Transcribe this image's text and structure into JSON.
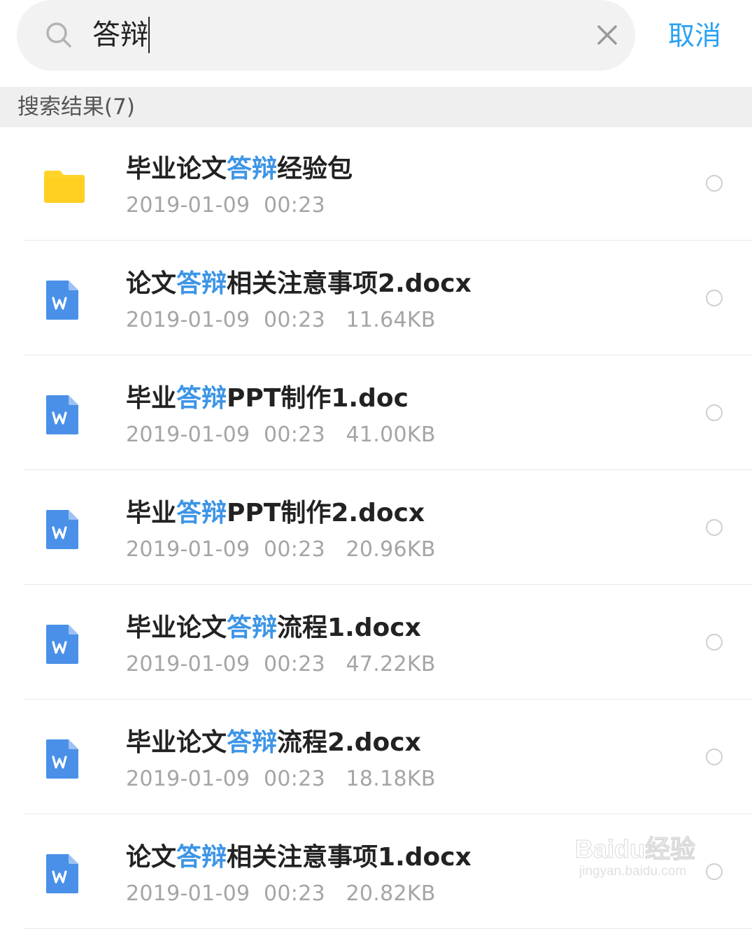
{
  "search": {
    "query": "答辩",
    "cancel_label": "取消"
  },
  "results_header": "搜索结果(7)",
  "highlight_color": "#3d95e6",
  "items": [
    {
      "type": "folder",
      "icon": "folder-icon",
      "title_before": "毕业论文",
      "title_match": "答辩",
      "title_after": "经验包",
      "meta": "2019-01-09  00:23"
    },
    {
      "type": "word",
      "icon": "word-doc-icon",
      "title_before": "论文",
      "title_match": "答辩",
      "title_after": "相关注意事项2.docx",
      "meta": "2019-01-09  00:23   11.64KB"
    },
    {
      "type": "word",
      "icon": "word-doc-icon",
      "title_before": "毕业",
      "title_match": "答辩",
      "title_after": "PPT制作1.doc",
      "meta": "2019-01-09  00:23   41.00KB"
    },
    {
      "type": "word",
      "icon": "word-doc-icon",
      "title_before": "毕业",
      "title_match": "答辩",
      "title_after": "PPT制作2.docx",
      "meta": "2019-01-09  00:23   20.96KB"
    },
    {
      "type": "word",
      "icon": "word-doc-icon",
      "title_before": "毕业论文",
      "title_match": "答辩",
      "title_after": "流程1.docx",
      "meta": "2019-01-09  00:23   47.22KB"
    },
    {
      "type": "word",
      "icon": "word-doc-icon",
      "title_before": "毕业论文",
      "title_match": "答辩",
      "title_after": "流程2.docx",
      "meta": "2019-01-09  00:23   18.18KB"
    },
    {
      "type": "word",
      "icon": "word-doc-icon",
      "title_before": "论文",
      "title_match": "答辩",
      "title_after": "相关注意事项1.docx",
      "meta": "2019-01-09  00:23   20.82KB"
    }
  ],
  "watermark": {
    "brand": "Baidu经验",
    "url": "jingyan.baidu.com"
  }
}
